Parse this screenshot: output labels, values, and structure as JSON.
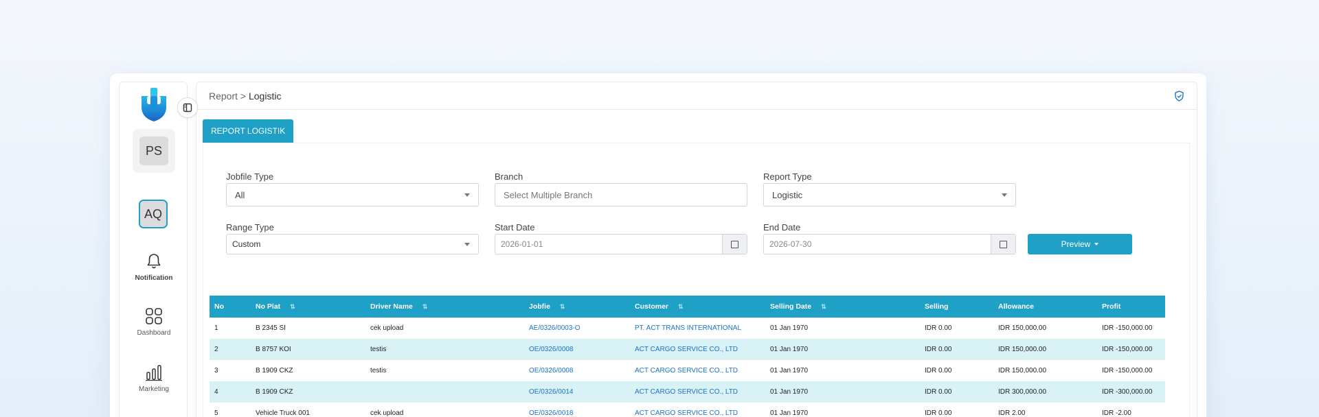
{
  "sidebar": {
    "user_initials": "PS",
    "workspace_initials": "AQ",
    "nav": [
      {
        "label": "Notification",
        "icon": "bell-icon"
      },
      {
        "label": "Dashboard",
        "icon": "grid-icon"
      },
      {
        "label": "Marketing",
        "icon": "bar-chart-icon"
      }
    ]
  },
  "header": {
    "breadcrumb_parent": "Report >",
    "breadcrumb_current": "Logistic"
  },
  "tab": {
    "label": "REPORT LOGISTIK"
  },
  "filters": {
    "jobfile_type": {
      "label": "Jobfile Type",
      "value": "All"
    },
    "branch": {
      "label": "Branch",
      "placeholder": "Select Multiple Branch"
    },
    "report_type": {
      "label": "Report Type",
      "value": "Logistic"
    },
    "range_type": {
      "label": "Range Type",
      "value": "Custom"
    },
    "start_date": {
      "label": "Start Date",
      "value": "2026-01-01"
    },
    "end_date": {
      "label": "End Date",
      "value": "2026-07-30"
    },
    "preview_label": "Preview"
  },
  "table": {
    "headers": [
      "No",
      "No Plat",
      "Driver Name",
      "Jobfie",
      "Customer",
      "Selling Date",
      "Selling",
      "Allowance",
      "Profit"
    ],
    "rows": [
      [
        "1",
        "B 2345 SI",
        "cek upload",
        "AE/0326/0003-O",
        "PT. ACT TRANS INTERNATIONAL",
        "01 Jan 1970",
        "IDR 0.00",
        "IDR 150,000.00",
        "IDR -150,000.00"
      ],
      [
        "2",
        "B 8757 KOI",
        "testis",
        "OE/0326/0008",
        "ACT CARGO SERVICE CO., LTD",
        "01 Jan 1970",
        "IDR 0.00",
        "IDR 150,000.00",
        "IDR -150,000.00"
      ],
      [
        "3",
        "B 1909 CKZ",
        "testis",
        "OE/0326/0008",
        "ACT CARGO SERVICE CO., LTD",
        "01 Jan 1970",
        "IDR 0.00",
        "IDR 150,000.00",
        "IDR -150,000.00"
      ],
      [
        "4",
        "B 1909 CKZ",
        "",
        "OE/0326/0014",
        "ACT CARGO SERVICE CO., LTD",
        "01 Jan 1970",
        "IDR 0.00",
        "IDR 300,000.00",
        "IDR -300,000.00"
      ],
      [
        "5",
        "Vehicle Truck 001",
        "cek upload",
        "OE/0326/0018",
        "ACT CARGO SERVICE CO., LTD",
        "01 Jan 1970",
        "IDR 0.00",
        "IDR 2.00",
        "IDR -2.00"
      ]
    ]
  },
  "colors": {
    "accent": "#1fa0c6",
    "row_alt": "#d8f2f5",
    "link": "#1a73c6"
  }
}
